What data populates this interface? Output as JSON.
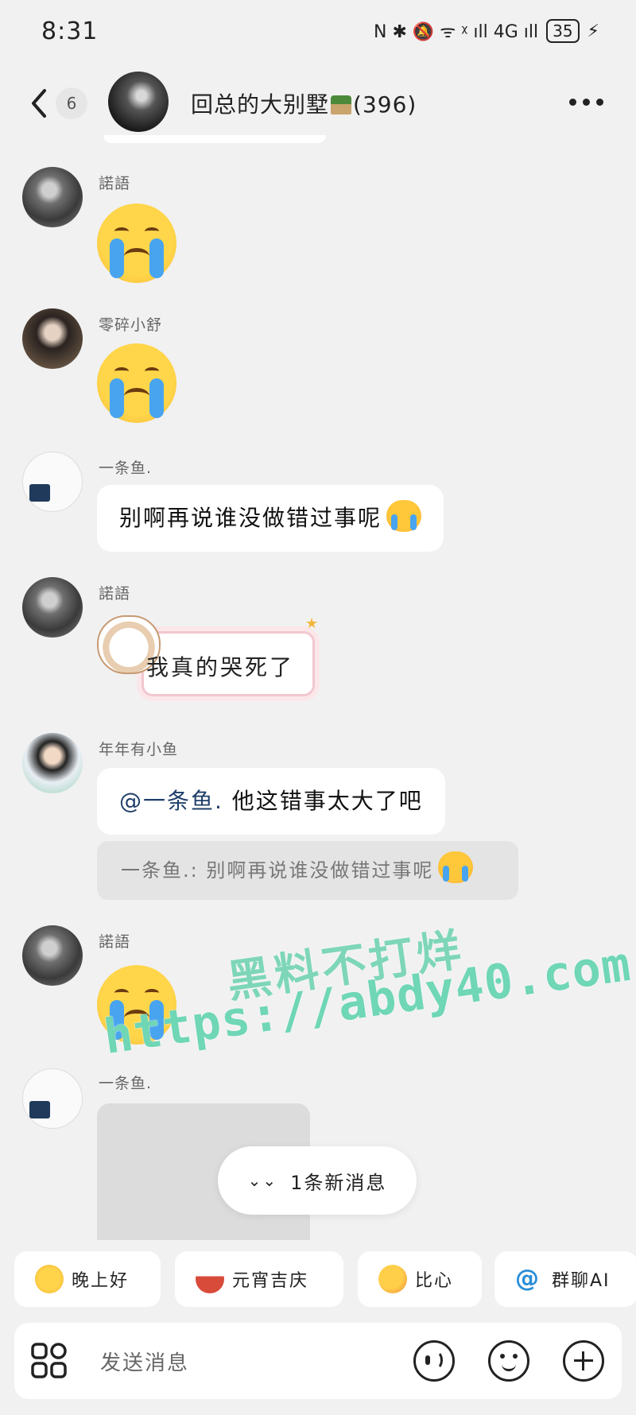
{
  "status_bar": {
    "time": "8:31",
    "icons_text": "N ✱ 🔕 ᯤ ᵡ ıll 4G ıll",
    "battery": "35"
  },
  "header": {
    "back_count": "6",
    "group_name": "回总的大别墅",
    "member_count": "(396)"
  },
  "messages": [
    {
      "sender": "諾語",
      "kind": "sticker",
      "icon": "loudly-crying-face-icon"
    },
    {
      "sender": "零碎小舒",
      "kind": "sticker",
      "icon": "loudly-crying-face-icon"
    },
    {
      "sender": "一条鱼.",
      "kind": "text",
      "text": "别啊再说谁没做错过事呢"
    },
    {
      "sender": "諾語",
      "kind": "sticker-card",
      "text": "我真的哭死了"
    },
    {
      "sender": "年年有小鱼",
      "kind": "text",
      "mention": "@一条鱼.",
      "text": " 他这错事太大了吧",
      "quote": "一条鱼.: 别啊再说谁没做错过事呢"
    },
    {
      "sender": "諾語",
      "kind": "sticker",
      "icon": "loudly-crying-face-icon"
    },
    {
      "sender": "一条鱼.",
      "kind": "image"
    }
  ],
  "watermark": {
    "line1": "黑料不打烊",
    "line2": "https://abdy40.com"
  },
  "new_messages_pill": {
    "label": "1条新消息"
  },
  "quick_replies": [
    {
      "label": "晚上好",
      "icon": "star-face-icon"
    },
    {
      "label": "元宵吉庆",
      "icon": "bowl-icon"
    },
    {
      "label": "比心",
      "icon": "duck-heart-icon"
    },
    {
      "label": "群聊AI",
      "icon": "at-icon",
      "glyph": "@"
    }
  ],
  "input": {
    "placeholder": "发送消息"
  }
}
